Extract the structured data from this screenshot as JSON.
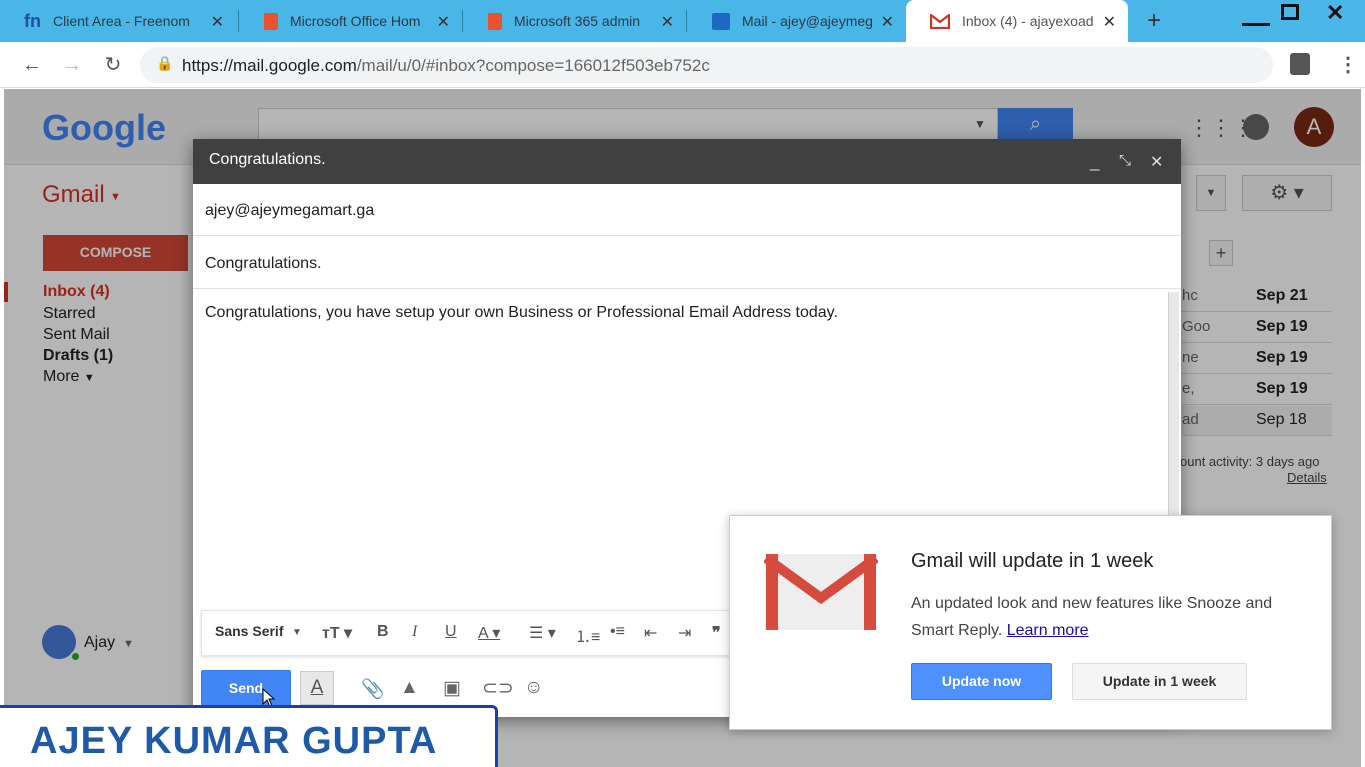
{
  "browser": {
    "tabs": [
      {
        "title": "Client Area - Freenom",
        "icon": "freenom-icon",
        "icon_text": "fn"
      },
      {
        "title": "Microsoft Office Hom",
        "icon": "office-icon"
      },
      {
        "title": "Microsoft 365 admin",
        "icon": "office-icon"
      },
      {
        "title": "Mail - ajey@ajeymeg",
        "icon": "outlook-icon"
      },
      {
        "title": "Inbox (4) - ajayexoad",
        "icon": "gmail-icon",
        "active": true
      }
    ],
    "url_main": "https://mail.google.com",
    "url_path": "/mail/u/0/#inbox?compose=166012f503eb752c",
    "colors": {
      "tabbar": "#4ab6e8",
      "active_tab": "#ffffff"
    }
  },
  "gmail": {
    "logo": "Google",
    "app_label": "Gmail",
    "compose_label": "COMPOSE",
    "nav": [
      {
        "label": "Inbox (4)",
        "bold": true,
        "active": true
      },
      {
        "label": "Starred"
      },
      {
        "label": "Sent Mail"
      },
      {
        "label": "Drafts (1)",
        "bold": true
      },
      {
        "label": "More"
      }
    ],
    "user_name": "Ajay",
    "avatar_letter": "A",
    "row_snippets": [
      "hc",
      "Goo",
      "ne",
      "e,",
      "ad"
    ],
    "row_dates": [
      "Sep 21",
      "Sep 19",
      "Sep 19",
      "Sep 19",
      "Sep 18"
    ],
    "activity_text": "ount activity: 3 days ago",
    "details_label": "Details"
  },
  "compose": {
    "header_title": "Congratulations.",
    "to": "ajey@ajeymegamart.ga",
    "subject": "Congratulations.",
    "body": "Congratulations, you have setup your own Business or Professional Email Address today.",
    "font_label": "Sans Serif",
    "send_label": "Send"
  },
  "popup": {
    "title": "Gmail will update in 1 week",
    "text": "An updated look and new features like Snooze and Smart Reply.",
    "link": "Learn more",
    "primary_button": "Update now",
    "secondary_button": "Update in 1 week"
  },
  "banner": {
    "text": "AJEY KUMAR GUPTA"
  }
}
